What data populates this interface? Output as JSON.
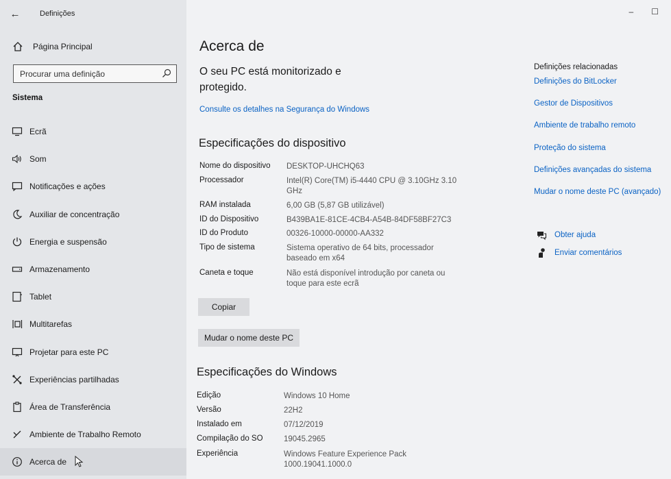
{
  "window": {
    "title": "Definições",
    "controls": {
      "minimize": "–",
      "maximize": "☐"
    }
  },
  "sidebar": {
    "home_label": "Página Principal",
    "search_placeholder": "Procurar uma definição",
    "section_title": "Sistema",
    "items": [
      {
        "label": "Ecrã",
        "icon": "display-icon"
      },
      {
        "label": "Som",
        "icon": "speaker-icon"
      },
      {
        "label": "Notificações e ações",
        "icon": "notifications-icon"
      },
      {
        "label": "Auxiliar de concentração",
        "icon": "moon-icon"
      },
      {
        "label": "Energia e suspensão",
        "icon": "power-icon"
      },
      {
        "label": "Armazenamento",
        "icon": "storage-icon"
      },
      {
        "label": "Tablet",
        "icon": "tablet-icon"
      },
      {
        "label": "Multitarefas",
        "icon": "multitask-icon"
      },
      {
        "label": "Projetar para este PC",
        "icon": "project-icon"
      },
      {
        "label": "Experiências partilhadas",
        "icon": "shared-icon"
      },
      {
        "label": "Área de Transferência",
        "icon": "clipboard-icon"
      },
      {
        "label": "Ambiente de Trabalho Remoto",
        "icon": "remote-icon"
      },
      {
        "label": "Acerca de",
        "icon": "info-icon"
      }
    ]
  },
  "main": {
    "title": "Acerca de",
    "protection_status": "O seu PC está monitorizado e protegido.",
    "security_link": "Consulte os detalhes na Segurança do Windows",
    "device_specs_title": "Especificações do dispositivo",
    "device_specs": [
      {
        "key": "Nome do dispositivo",
        "value": "DESKTOP-UHCHQ63"
      },
      {
        "key": "Processador",
        "value": "Intel(R) Core(TM) i5-4440 CPU @ 3.10GHz   3.10 GHz"
      },
      {
        "key": "RAM instalada",
        "value": "6,00 GB (5,87 GB utilizável)"
      },
      {
        "key": "ID do Dispositivo",
        "value": "B439BA1E-81CE-4CB4-A54B-84DF58BF27C3"
      },
      {
        "key": "ID do Produto",
        "value": "00326-10000-00000-AA332"
      },
      {
        "key": "Tipo de sistema",
        "value": "Sistema operativo de 64 bits, processador baseado em x64"
      },
      {
        "key": "Caneta e toque",
        "value": "Não está disponível introdução por caneta ou toque para este ecrã"
      }
    ],
    "copy_button": "Copiar",
    "rename_button": "Mudar o nome deste PC",
    "windows_specs_title": "Especificações do Windows",
    "windows_specs": [
      {
        "key": "Edição",
        "value": "Windows 10 Home"
      },
      {
        "key": "Versão",
        "value": "22H2"
      },
      {
        "key": "Instalado em",
        "value": "07/12/2019"
      },
      {
        "key": "Compilação do SO",
        "value": "19045.2965"
      },
      {
        "key": "Experiência",
        "value": "Windows Feature Experience Pack 1000.19041.1000.0"
      }
    ]
  },
  "related": {
    "title": "Definições relacionadas",
    "links": [
      "Definições do BitLocker",
      "Gestor de Dispositivos",
      "Ambiente de trabalho remoto",
      "Proteção do sistema",
      "Definições avançadas do sistema",
      "Mudar o nome deste PC (avançado)"
    ],
    "help_label": "Obter ajuda",
    "feedback_label": "Enviar comentários"
  },
  "colors": {
    "accent": "#0a62c4",
    "sidebar_bg": "#e4e6e9",
    "content_bg": "#f1f2f4"
  }
}
